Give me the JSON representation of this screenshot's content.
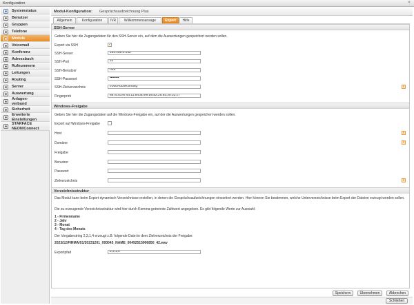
{
  "window": {
    "title": "Konfiguration",
    "close_symbol": "×"
  },
  "sidebar": {
    "items": [
      {
        "label": "Systemstatus",
        "icon": "monitor-icon"
      },
      {
        "label": "Benutzer",
        "icon": "user-icon"
      },
      {
        "label": "Gruppen",
        "icon": "group-icon"
      },
      {
        "label": "Telefone",
        "icon": "phone-icon"
      },
      {
        "label": "Module",
        "icon": "module-icon",
        "active": true
      },
      {
        "label": "Voicemail",
        "icon": "voicemail-icon"
      },
      {
        "label": "Konferenz",
        "icon": "conference-icon"
      },
      {
        "label": "Adressbuch",
        "icon": "addressbook-icon"
      },
      {
        "label": "Rufnummern",
        "icon": "numbers-icon"
      },
      {
        "label": "Leitungen",
        "icon": "lines-icon"
      },
      {
        "label": "Routing",
        "icon": "routing-icon"
      },
      {
        "label": "Server",
        "icon": "server-icon"
      },
      {
        "label": "Auswertung",
        "icon": "chart-icon"
      },
      {
        "label": "Anlagen-\nverbund",
        "icon": "network-icon"
      },
      {
        "label": "Sicherheit",
        "icon": "lock-icon"
      },
      {
        "label": "Erweiterte\nEinstellungen",
        "icon": "settings-icon"
      },
      {
        "label": "STARFACE\nNEON/Connect",
        "icon": "connect-icon"
      }
    ]
  },
  "header": {
    "label": "Modul-Konfiguration:",
    "module_name": "Gesprächsaufzeichnung Plus"
  },
  "tabs": [
    "Allgemein",
    "Konfiguration",
    "IVR",
    "Willkommensansage",
    "Export",
    "Hilfe"
  ],
  "active_tab": "Export",
  "ssh": {
    "title": "SSH-Server",
    "description": "Geben Sie hier die Zugangsdaten für den SSH-Server ein, auf dem die Auswertungen gespeichert werden sollen.",
    "export_label": "Export via SSH",
    "export_checked": true,
    "server_label": "SSH-Server",
    "server_value": "192.168.0.142",
    "port_label": "SSH-Port",
    "port_value": "22",
    "user_label": "SSH-Benutzer",
    "user_value": "root",
    "password_label": "SSH-Passwort",
    "password_value": "••••••••",
    "dir_label": "SSH-Zielverzeichnis",
    "dir_value": "/root/Aufzeichnung",
    "fingerprint_label": "Fingerprint",
    "fingerprint_value": "66:f4:cd:ef:44:11:64:a0:e9:b9:a2:26:93:20:32:c7"
  },
  "windows": {
    "title": "Windows-Freigabe",
    "description": "Geben Sie hier die Zugangsdaten auf die Windows-Freigabe ein, auf der die Auswertungen gespeichert werden sollen.",
    "export_label": "Export auf Windows-Freigabe",
    "export_checked": false,
    "host_label": "Host",
    "host_value": "",
    "domain_label": "Domäne",
    "domain_value": "",
    "share_label": "Freigabe",
    "share_value": "",
    "user_label": "Benutzer",
    "user_value": "",
    "password_label": "Passwort",
    "password_value": "",
    "dir_label": "Zielverzeichnis",
    "dir_value": ""
  },
  "structure": {
    "title": "Verzeichnisstruktur",
    "description": "Das Modul kann beim Export dynamisch Verzeichnisse erstellen, in denen die Gesprächsaufzeichnungen einsortiert werden. Hier können Sie bestimmen, welche Unterverzeichnisse beim Export der Dateien erzeugt werden sollen.",
    "instruction": "Die zu erzeugende Verzeichnisstruktur wird hier durch Komma-getrennte Zahlwert angegeben. Es gibt folgende Werte zur Auswahl:",
    "options": [
      "1 - Firmenname",
      "2 - Jahr",
      "3 - Monat",
      "4 - Tag des Monats"
    ],
    "example_text": "Der Vorgabestring 2,3,1,4 erzeugt z.B. folgende Datei in dem Zielverzeichnis der Freigabe:",
    "example_path": "2023/12/FIRMA/01/20231201_093045_NAME_00492515906850_42.wav",
    "exportpath_label": "Exportpfad",
    "exportpath_value": "2,3,1,4"
  },
  "info_symbol": "i",
  "buttons": {
    "save": "Speichern",
    "apply": "Übernehmen",
    "cancel": "Abbrechen",
    "close": "Schließen"
  }
}
